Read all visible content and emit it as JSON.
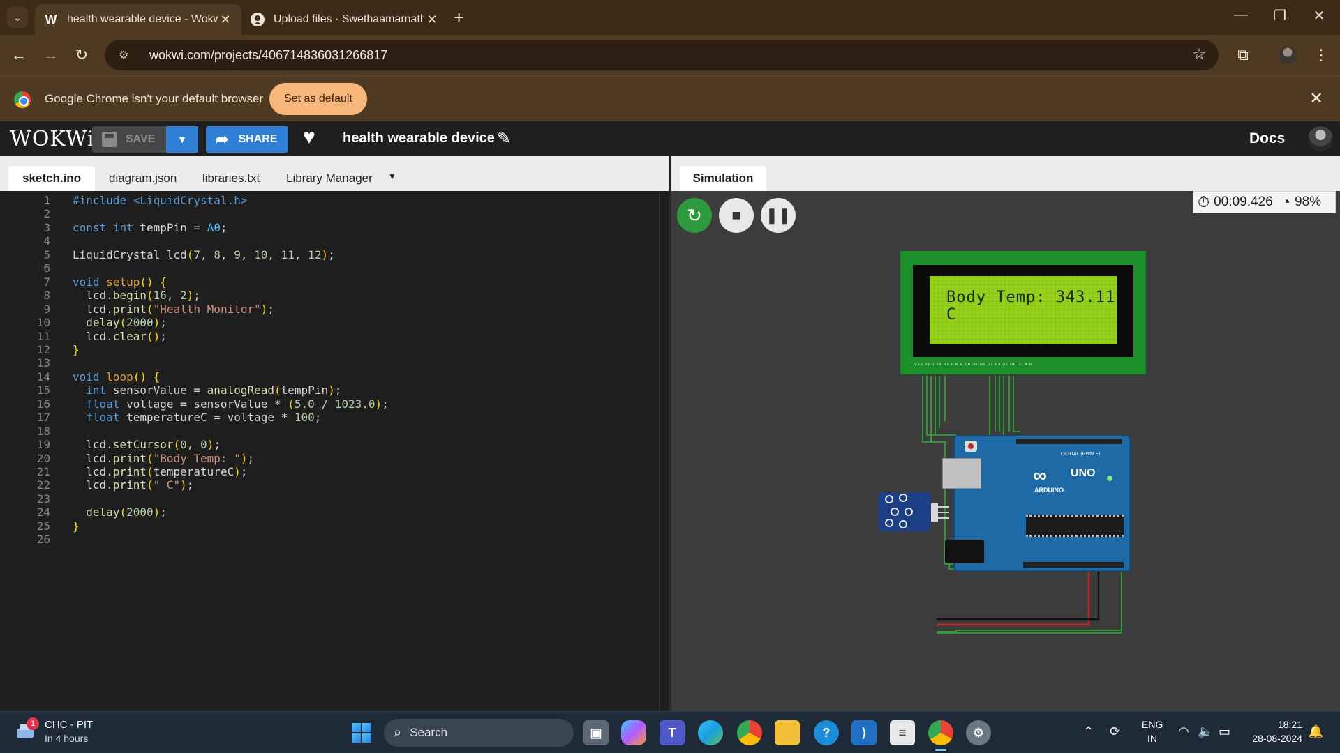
{
  "browser": {
    "tabs": [
      {
        "title": "health wearable device - Wokwi",
        "favicon": "W"
      },
      {
        "title": "Upload files · Swethaamarnath4",
        "favicon": "github-icon"
      }
    ],
    "url": "wokwi.com/projects/406714836031266817",
    "infobar": {
      "text": "Google Chrome isn't your default browser",
      "button": "Set as default"
    }
  },
  "wokwi": {
    "logo": "WOKWi",
    "save_label": "SAVE",
    "share_label": "SHARE",
    "project_title": "health wearable device",
    "docs_label": "Docs",
    "editor_tabs": [
      "sketch.ino",
      "diagram.json",
      "libraries.txt",
      "Library Manager"
    ],
    "active_editor_tab": "sketch.ino",
    "code_lines": [
      "#include <LiquidCrystal.h>",
      "",
      "const int tempPin = A0;",
      "",
      "LiquidCrystal lcd(7, 8, 9, 10, 11, 12);",
      "",
      "void setup() {",
      "  lcd.begin(16, 2);",
      "  lcd.print(\"Health Monitor\");",
      "  delay(2000);",
      "  lcd.clear();",
      "}",
      "",
      "void loop() {",
      "  int sensorValue = analogRead(tempPin);",
      "  float voltage = sensorValue * (5.0 / 1023.0);",
      "  float temperatureC = voltage * 100;",
      "",
      "  lcd.setCursor(0, 0);",
      "  lcd.print(\"Body Temp: \");",
      "  lcd.print(temperatureC);",
      "  lcd.print(\" C\");",
      "",
      "  delay(2000);",
      "}",
      ""
    ],
    "simulation": {
      "tab_label": "Simulation",
      "timer": "00:09.426",
      "speed": "98%",
      "lcd_text": "Body Temp: 343.11 C",
      "lcd_pin_labels": "VSS VDD V0 RS RW E D0 D1 D2 D3 D4 D5 D6 D7 A K",
      "arduino": {
        "uno": "UNO",
        "name": "ARDUINO",
        "digital": "DIGITAL (PWM ~)"
      }
    }
  },
  "taskbar": {
    "weather_title": "CHC - PIT",
    "weather_sub": "In 4 hours",
    "badge": "1",
    "search_placeholder": "Search",
    "lang_1": "ENG",
    "lang_2": "IN",
    "time": "18:21",
    "date": "28-08-2024"
  },
  "colors": {
    "browser_frame": "#3b2a17",
    "wokwi_blue": "#2f7fd6",
    "lcd_green": "#95d11b",
    "arduino_blue": "#1d6aa6"
  }
}
